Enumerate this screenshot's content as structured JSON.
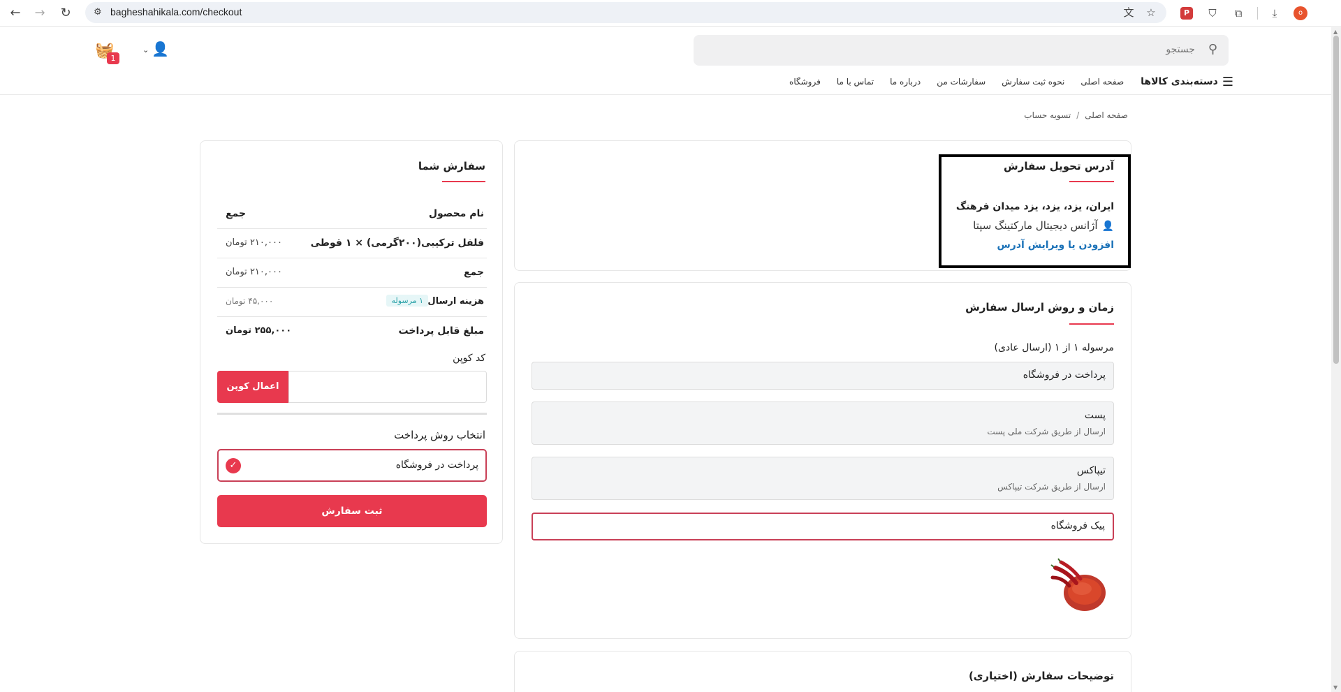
{
  "browser": {
    "url": "bagheshahikala.com/checkout",
    "profile_initial": "o",
    "ext_badge": "P"
  },
  "header": {
    "search_placeholder": "جستجو",
    "cart_count": "1"
  },
  "nav": {
    "categories": "دسته‌بندی کالاها",
    "links": [
      "صفحه اصلی",
      "نحوه ثبت سفارش",
      "سفارشات من",
      "درباره ما",
      "تماس با ما",
      "فروشگاه"
    ]
  },
  "breadcrumb": {
    "home": "صفحه اصلی",
    "sep": "/",
    "current": "تسویه حساب"
  },
  "address": {
    "title": "آدرس تحویل سفارش",
    "line": "ایران، یزد، یزد، یزد میدان فرهنگ",
    "recipient": "آژانس دیجیتال مارکتینگ سپتا",
    "edit_link": "افزودن یا ویرایش آدرس"
  },
  "shipping": {
    "title": "زمان و روش ارسال سفارش",
    "subtitle": "مرسوله ۱ از ۱ (ارسال عادی)",
    "options": [
      {
        "title": "پرداخت در فروشگاه",
        "sub": ""
      },
      {
        "title": "پست",
        "sub": "ارسال از طریق شرکت ملی پست"
      },
      {
        "title": "تیپاکس",
        "sub": "ارسال از طریق شرکت تیپاکس"
      },
      {
        "title": "پیک فروشگاه",
        "sub": ""
      }
    ]
  },
  "notes": {
    "title": "توضیحات سفارش (اختیاری)"
  },
  "order": {
    "title": "سفارش شما",
    "col_product": "نام محصول",
    "col_total": "جمع",
    "item_name": "فلفل ترکیبی(۲۰۰گرمی) × ۱ قوطی",
    "item_price": "۲۱۰,۰۰۰ تومان",
    "subtotal_label": "جمع",
    "subtotal_value": "۲۱۰,۰۰۰ تومان",
    "shipping_label": "هزینه ارسال",
    "shipping_badge": "۱ مرسوله",
    "shipping_value": "۴۵,۰۰۰ تومان",
    "payable_label": "مبلغ قابل پرداخت",
    "payable_value": "۲۵۵,۰۰۰ تومان",
    "coupon_label": "کد کوپن",
    "coupon_button": "اعمال کوپن",
    "payment_title": "انتخاب روش پرداخت",
    "payment_option": "پرداخت در فروشگاه",
    "submit": "ثبت سفارش"
  },
  "colors": {
    "accent": "#e8394e",
    "link": "#1b72b8",
    "badge_bg": "#e6f6f7",
    "badge_text": "#2aa1a8"
  },
  "icons": [
    "back-icon",
    "forward-icon",
    "reload-icon",
    "site-settings-icon",
    "translate-icon",
    "star-icon",
    "shield-icon",
    "puzzle-icon",
    "download-icon",
    "search-icon",
    "basket-icon",
    "user-icon",
    "chevron-down-icon",
    "menu-icon",
    "person-icon",
    "check-icon"
  ]
}
